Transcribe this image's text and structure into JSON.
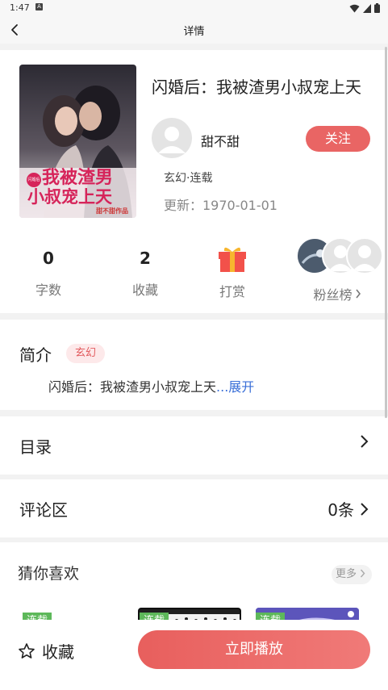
{
  "status_bar": {
    "time": "1:47",
    "notification_icon": "A"
  },
  "nav": {
    "title": "详情"
  },
  "book": {
    "title": "闪婚后：我被渣男小叔宠上天",
    "cover_text_line1": "我被渣男",
    "cover_text_line2": "小叔宠上天",
    "cover_badge": "闪婚后",
    "cover_author_line": "甜不甜作品",
    "author": "甜不甜",
    "follow_label": "关注",
    "tags": "玄幻·连载",
    "update": "更新：1970-01-01"
  },
  "stats": {
    "words_value": "0",
    "words_label": "字数",
    "favorites_value": "2",
    "favorites_label": "收藏",
    "reward_label": "打赏",
    "fans_label": "粉丝榜"
  },
  "intro": {
    "title": "简介",
    "tag": "玄幻",
    "text": "闪婚后：我被渣男小叔宠上天",
    "more": "...展开"
  },
  "catalog": {
    "label": "目录"
  },
  "comments": {
    "label": "评论区",
    "count": "0条"
  },
  "guess": {
    "title": "猜你喜欢",
    "more": "更多",
    "items": [
      {
        "badge": "连载"
      },
      {
        "badge": "连载"
      },
      {
        "badge": "连载"
      }
    ]
  },
  "bottom": {
    "collect_label": "收藏",
    "play_label": "立即播放"
  },
  "colors": {
    "accent": "#e96564",
    "tag_bg": "#fde9ea",
    "link": "#3a6fd8",
    "badge_green": "#5db85a"
  },
  "icons": [
    "back-icon",
    "wifi-icon",
    "signal-icon",
    "battery-icon",
    "gift-icon",
    "chevron-right-icon",
    "star-icon",
    "user-placeholder-icon"
  ]
}
